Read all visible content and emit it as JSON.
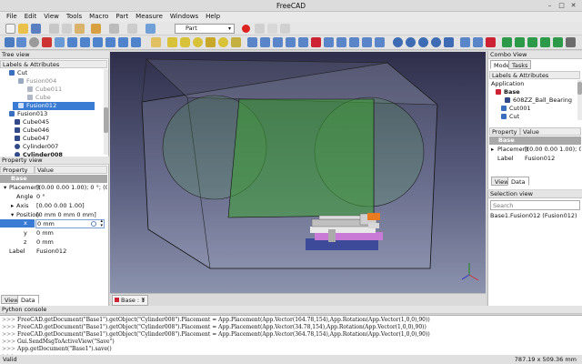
{
  "window": {
    "title": "FreeCAD"
  },
  "menu": [
    "File",
    "Edit",
    "View",
    "Tools",
    "Macro",
    "Part",
    "Measure",
    "Windows",
    "Help"
  ],
  "toolbar": {
    "workbench": "Part"
  },
  "tree_view": {
    "title": "Tree view",
    "header": "Labels & Attributes",
    "items": [
      "Cut",
      "Fusion004",
      "Cube011",
      "Cube",
      "Fusion012",
      "Fusion013",
      "Cube045",
      "Cube046",
      "Cube047",
      "Cylinder007",
      "Cylinder008"
    ]
  },
  "property_view": {
    "title": "Property view",
    "col_property": "Property",
    "col_value": "Value",
    "group": "Base",
    "rows": [
      {
        "name": "Placement",
        "value": "[(0.00 0.00 1.00); 0 °; (0 mm..."
      },
      {
        "name": "Angle",
        "value": "0 °"
      },
      {
        "name": "Axis",
        "value": "[0.00 0.00 1.00]"
      },
      {
        "name": "Position",
        "value": "[0 mm  0 mm  0 mm]"
      },
      {
        "name": "x",
        "value": "0 mm"
      },
      {
        "name": "y",
        "value": "0 mm"
      },
      {
        "name": "z",
        "value": "0 mm"
      },
      {
        "name": "Label",
        "value": "Fusion012"
      }
    ],
    "tabs": [
      "View",
      "Data"
    ]
  },
  "viewport": {
    "tab_label": "Base : 1"
  },
  "combo_view": {
    "title": "Combo View",
    "tabs": [
      "Model",
      "Tasks"
    ],
    "header": "Labels & Attributes",
    "application": "Application",
    "items": [
      "Base",
      "608ZZ_Ball_Bearing",
      "Cut001",
      "Cut"
    ],
    "col_property": "Property",
    "col_value": "Value",
    "group": "Base",
    "rows": [
      {
        "name": "Placement",
        "value": "[(0.00 0.00 1.00); 0 °; ..."
      },
      {
        "name": "Label",
        "value": "Fusion012"
      }
    ],
    "bottom_tabs": [
      "View",
      "Data"
    ]
  },
  "selection_view": {
    "title": "Selection view",
    "search_placeholder": "Search",
    "item": "Base1.Fusion012 (Fusion012)"
  },
  "python_console": {
    "title": "Python console",
    "lines": [
      {
        "prompt": ">>>",
        "text": "FreeCAD.getDocument(\"Base1\").getObject(\"Cylinder008\").Placement = App.Placement(App.Vector(164.78,154),App.Rotation(App.Vector(1,0,0),90))"
      },
      {
        "prompt": ">>>",
        "text": "FreeCAD.getDocument(\"Base1\").getObject(\"Cylinder008\").Placement = App.Placement(App.Vector(34.78,154),App.Rotation(App.Vector(1,0,0),90))"
      },
      {
        "prompt": ">>>",
        "text": "FreeCAD.getDocument(\"Base1\").getObject(\"Cylinder008\").Placement = App.Placement(App.Vector(364.78,154),App.Rotation(App.Vector(1,0,0),90))"
      },
      {
        "prompt": ">>>",
        "text": "Gui.SendMsgToActiveView(\"Save\")"
      },
      {
        "prompt": ">>>",
        "text": "App.getDocument(\"Base1\").save()"
      },
      {
        "prompt": ">>>",
        "text": ""
      }
    ]
  },
  "status": {
    "left": "Valid",
    "right": "787.19 x 509.36 mm"
  },
  "colors": {
    "selection": "#3a7cd4",
    "viewport_top": "#2f2f4b",
    "viewport_bottom": "#8c93ad",
    "highlight_green": "#3a8a2a"
  }
}
